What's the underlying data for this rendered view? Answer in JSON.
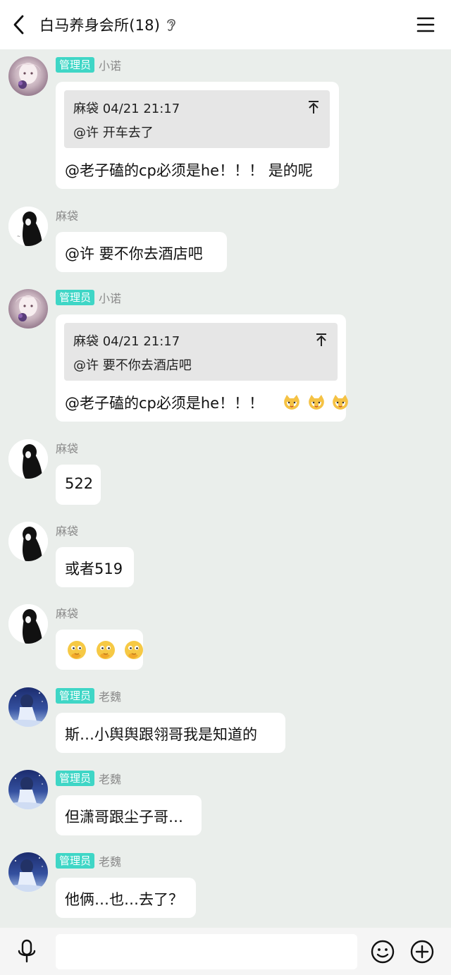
{
  "header": {
    "title": "白马养身会所(18)"
  },
  "messages": [
    {
      "sender": "小诺",
      "badge": "管理员",
      "quote_head": "麻袋 04/21 21:17",
      "quote_body": "@许 开车去了",
      "text": "@老子磕的cp必须是he！！！ 是的呢"
    },
    {
      "sender": "麻袋",
      "text": "@许 要不你去酒店吧"
    },
    {
      "sender": "小诺",
      "badge": "管理员",
      "quote_head": "麻袋 04/21 21:17",
      "quote_body": "@许 要不你去酒店吧",
      "text": "@老子磕的cp必须是he！！！"
    },
    {
      "sender": "麻袋",
      "text": "522"
    },
    {
      "sender": "麻袋",
      "text": "或者519"
    },
    {
      "sender": "麻袋"
    },
    {
      "sender": "老魏",
      "badge": "管理员",
      "text": "斯…小舆舆跟翎哥我是知道的"
    },
    {
      "sender": "老魏",
      "badge": "管理员",
      "text": "但潇哥跟尘子哥…"
    },
    {
      "sender": "老魏",
      "badge": "管理员",
      "text": "他俩…也…去了？"
    }
  ],
  "input": {
    "placeholder": ""
  },
  "icons": {
    "back": "chevron-left-icon",
    "ear": "ear-icon",
    "menu": "hamburger-menu-icon",
    "quote_top": "pin-top-icon",
    "mic": "microphone-icon",
    "emoji": "smiley-icon",
    "plus": "plus-circle-icon"
  },
  "colors": {
    "badge": "#3fd6c6",
    "background": "#eaeeeb",
    "bubble": "#ffffff",
    "quote": "#e6e6e6"
  }
}
